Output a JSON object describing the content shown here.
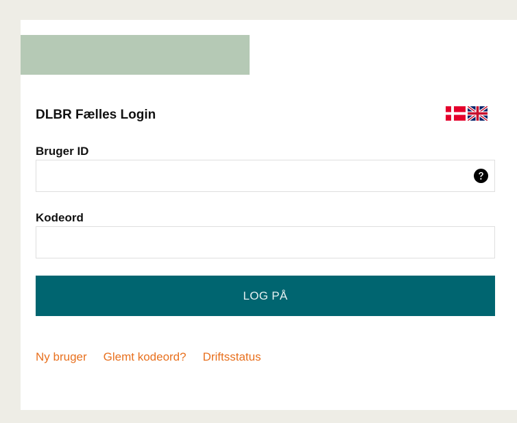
{
  "login": {
    "title": "DLBR Fælles Login",
    "user_label": "Bruger ID",
    "user_value": "",
    "password_label": "Kodeord",
    "password_value": "",
    "submit_label": "LOG PÅ"
  },
  "links": {
    "new_user": "Ny bruger",
    "forgot_password": "Glemt kodeord?",
    "status": "Driftsstatus"
  },
  "icons": {
    "flag_danish": "danish-flag-icon",
    "flag_english": "uk-flag-icon",
    "help": "question-circle-icon"
  },
  "colors": {
    "page_bg": "#eeede6",
    "logo_bar": "#b5c9b5",
    "button": "#006570",
    "link": "#e8701e"
  }
}
